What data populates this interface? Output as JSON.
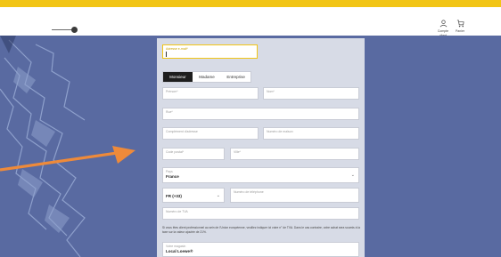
{
  "colors": {
    "accent": "#f2c515",
    "background": "#596aa1",
    "form": "#d7dbe6",
    "arrow": "#ee8a3a"
  },
  "header": {
    "icons": [
      {
        "icon": "user-icon",
        "label": "Compte client"
      },
      {
        "icon": "cart-icon",
        "label": "Panier"
      }
    ]
  },
  "form": {
    "top_field": {
      "placeholder": "Adresse e-mail*",
      "value": ""
    },
    "tabs": [
      {
        "label": "Monsieur",
        "active": true
      },
      {
        "label": "Madame",
        "active": false
      },
      {
        "label": "Entreprise",
        "active": false
      }
    ],
    "fields": {
      "first_name": {
        "placeholder": "Prénom*",
        "value": ""
      },
      "last_name": {
        "placeholder": "Nom*",
        "value": ""
      },
      "street": {
        "placeholder": "Rue*",
        "value": ""
      },
      "address_extra": {
        "placeholder": "Complément d'adresse",
        "value": ""
      },
      "house_number": {
        "placeholder": "Numéro de maison",
        "value": ""
      },
      "postal_code": {
        "placeholder": "Code postal*",
        "value": ""
      },
      "city": {
        "placeholder": "Ville*",
        "value": ""
      },
      "country": {
        "placeholder": "Pays",
        "value": "France"
      },
      "phone_prefix": {
        "placeholder": "",
        "value": "FR (+33)"
      },
      "phone": {
        "placeholder": "Numéro de téléphone",
        "value": ""
      },
      "vat": {
        "placeholder": "Numéro de TVA",
        "value": ""
      },
      "store": {
        "placeholder": "Votre magasin",
        "value": "Local Loewe®"
      }
    },
    "note": "Si vous êtes client professionnel au sein de l'Union européenne, veuillez indiquer ici votre n° de TVA. Dans le cas contraire, votre achat sera soumis à la taxe sur la valeur ajoutée de 21%."
  }
}
